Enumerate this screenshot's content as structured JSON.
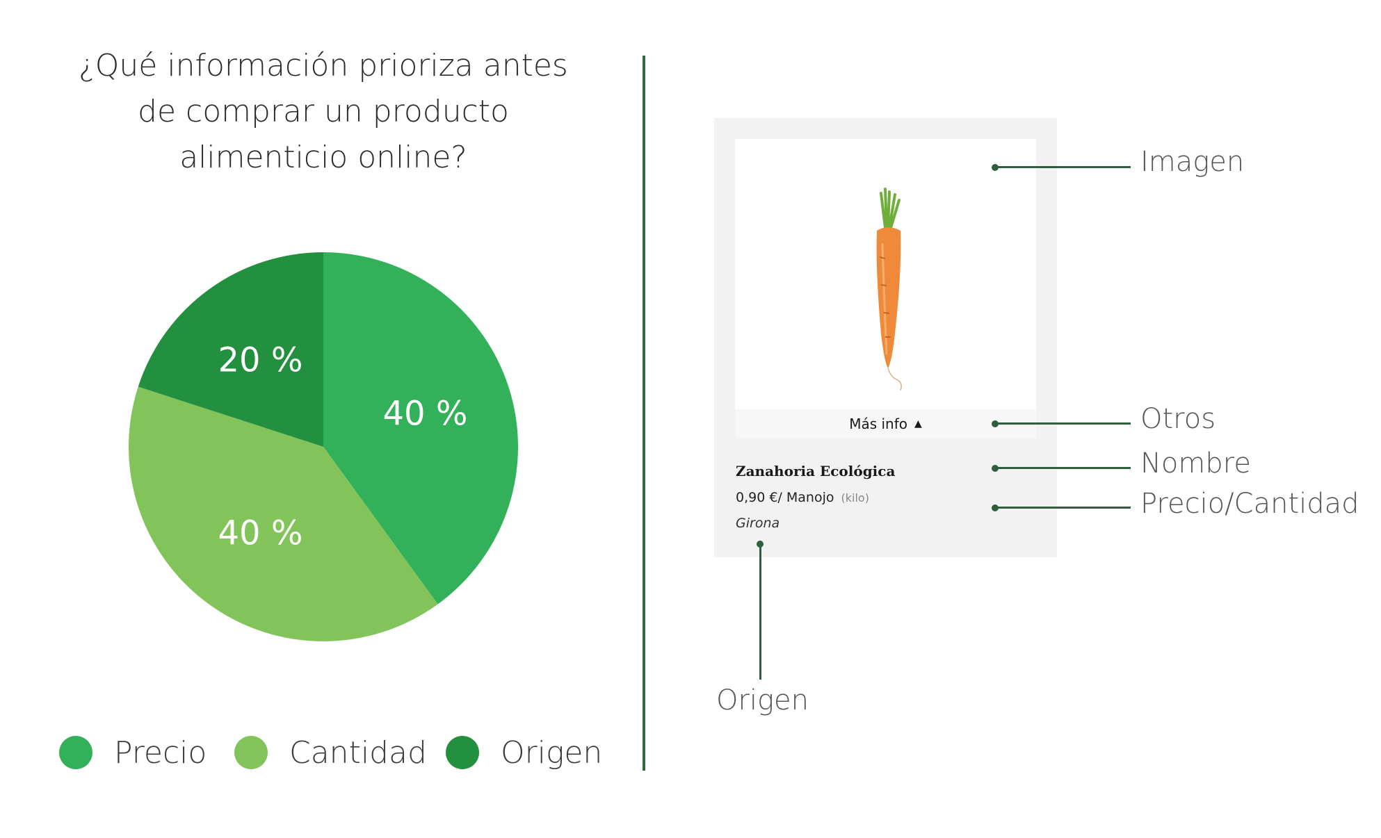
{
  "chart_data": {
    "type": "pie",
    "title": "¿Qué información prioriza antes de comprar un producto alimenticio online?",
    "title_lines": [
      "¿Qué información prioriza antes",
      "de comprar un producto",
      "alimenticio online?"
    ],
    "categories": [
      "Precio",
      "Cantidad",
      "Origen"
    ],
    "values": [
      40,
      40,
      20
    ],
    "labels": [
      "40 %",
      "40 %",
      "20 %"
    ],
    "colors": [
      "#33b15a",
      "#82c45a",
      "#22903f"
    ],
    "legend_position": "bottom"
  },
  "divider_color": "#2e6b40",
  "product_card": {
    "more_info_label": "Más info",
    "name": "Zanahoria Ecológica",
    "price": "0,90 €/ Manojo",
    "unit": "(kilo)",
    "origin": "Girona"
  },
  "annotations": {
    "imagen": "Imagen",
    "otros": "Otros",
    "nombre": "Nombre",
    "precio_cantidad": "Precio/Cantidad",
    "origen": "Origen"
  }
}
